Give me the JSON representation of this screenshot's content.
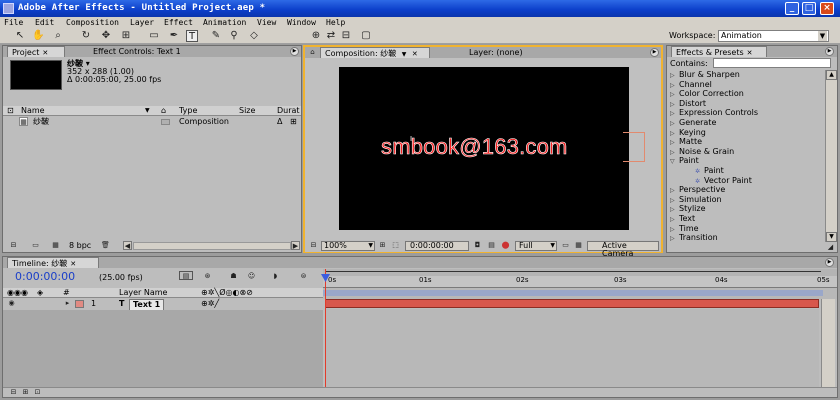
{
  "window": {
    "title": "Adobe After Effects - Untitled Project.aep *",
    "minimize": "_",
    "maximize": "□",
    "close": "×"
  },
  "menu": [
    "File",
    "Edit",
    "Composition",
    "Layer",
    "Effect",
    "Animation",
    "View",
    "Window",
    "Help"
  ],
  "toolbar": {
    "workspace_label": "Workspace:",
    "workspace_value": "Animation"
  },
  "project_panel": {
    "tab_project": "Project",
    "tab_effect_controls": "Effect Controls: Text 1",
    "item_name": "纱鞁 ▾",
    "item_dims": "352 x 288 (1.00)",
    "item_duration": "Δ 0:00:05:00, 25.00 fps",
    "columns": [
      "Name",
      "Type",
      "Size",
      "Durat"
    ],
    "rows": [
      {
        "name": "纱鞁",
        "type": "Composition"
      }
    ],
    "bpc": "8 bpc"
  },
  "composition_panel": {
    "tab_comp": "Composition: 纱鞁",
    "tab_layer": "Layer: (none)",
    "overlay_text": "smbook@163.com",
    "zoom": "100%",
    "timecode": "0:00:00:00",
    "resolution": "Full",
    "camera": "Active Camera"
  },
  "effects_panel": {
    "tab": "Effects & Presets",
    "contains_label": "Contains:",
    "items": [
      {
        "label": "Blur & Sharpen",
        "indent": 0,
        "open": false
      },
      {
        "label": "Channel",
        "indent": 0,
        "open": false
      },
      {
        "label": "Color Correction",
        "indent": 0,
        "open": false
      },
      {
        "label": "Distort",
        "indent": 0,
        "open": false
      },
      {
        "label": "Expression Controls",
        "indent": 0,
        "open": false
      },
      {
        "label": "Generate",
        "indent": 0,
        "open": false
      },
      {
        "label": "Keying",
        "indent": 0,
        "open": false
      },
      {
        "label": "Matte",
        "indent": 0,
        "open": false
      },
      {
        "label": "Noise & Grain",
        "indent": 0,
        "open": false
      },
      {
        "label": "Paint",
        "indent": 0,
        "open": true
      },
      {
        "label": "Paint",
        "indent": 1,
        "open": false
      },
      {
        "label": "Vector Paint",
        "indent": 1,
        "open": false
      },
      {
        "label": "Perspective",
        "indent": 0,
        "open": false
      },
      {
        "label": "Simulation",
        "indent": 0,
        "open": false
      },
      {
        "label": "Stylize",
        "indent": 0,
        "open": false
      },
      {
        "label": "Text",
        "indent": 0,
        "open": false
      },
      {
        "label": "Time",
        "indent": 0,
        "open": false
      },
      {
        "label": "Transition",
        "indent": 0,
        "open": false
      }
    ]
  },
  "timeline": {
    "tab": "Timeline: 纱鞁",
    "timecode": "0:00:00:00",
    "fps": "(25.00 fps)",
    "layer_name_header": "Layer Name",
    "ruler": [
      "0s",
      "01s",
      "02s",
      "03s",
      "04s",
      "05s"
    ],
    "layers": [
      {
        "num": "1",
        "type": "T",
        "name": "Text 1"
      }
    ]
  }
}
